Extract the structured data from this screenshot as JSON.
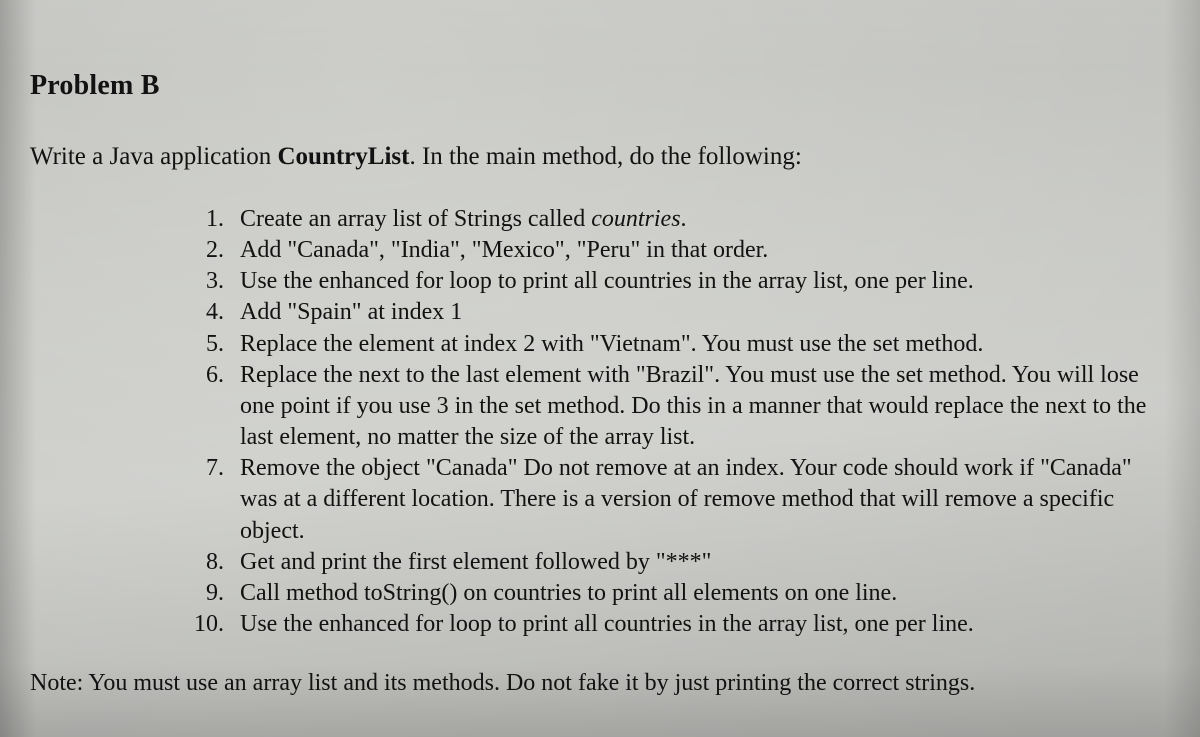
{
  "title": "Problem B",
  "intro_prefix": "Write a Java application ",
  "class_name": "CountryList",
  "intro_suffix": ". In the main method, do the following:",
  "steps": [
    {
      "pre": "Create an array list of Strings called ",
      "it": "countries",
      "post": "."
    },
    {
      "pre": "Add \"Canada\", \"India\", \"Mexico\", \"Peru\" in that order.",
      "it": "",
      "post": ""
    },
    {
      "pre": "Use the enhanced for loop to print all countries in the array list, one per line.",
      "it": "",
      "post": ""
    },
    {
      "pre": "Add \"Spain\" at index 1",
      "it": "",
      "post": ""
    },
    {
      "pre": "Replace the element at index 2 with \"Vietnam\". You must use the set method.",
      "it": "",
      "post": ""
    },
    {
      "pre": "Replace the next to the last element with \"Brazil\". You must use the set method. You will lose one point if you use 3 in the set method. Do this in a manner that would replace the next to the last element, no matter the size of the array list.",
      "it": "",
      "post": ""
    },
    {
      "pre": "Remove the object \"Canada\" Do not remove at an index. Your code should work if \"Canada\" was at a different location. There is a version of remove method that will remove a specific object.",
      "it": "",
      "post": ""
    },
    {
      "pre": "Get and print the first element followed by \"***\"",
      "it": "",
      "post": ""
    },
    {
      "pre": "Call method toString() on countries to print all elements on one line.",
      "it": "",
      "post": ""
    },
    {
      "pre": "Use the enhanced for loop to print all countries in the array list, one per line.",
      "it": "",
      "post": ""
    }
  ],
  "note": "Note: You must use an array list and its methods. Do not fake it by just printing the correct strings."
}
